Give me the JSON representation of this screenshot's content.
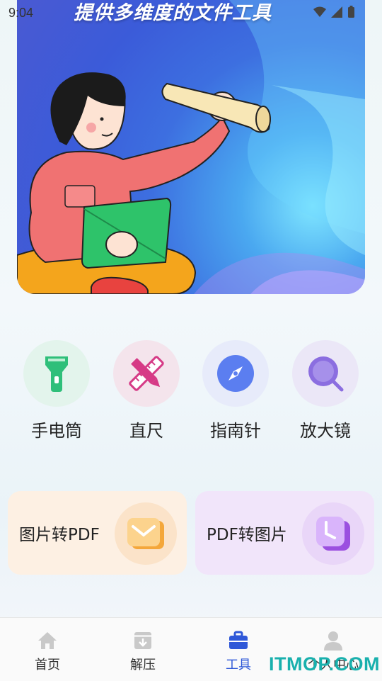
{
  "status_bar": {
    "time": "9:04"
  },
  "banner": {
    "title": "提供多维度的文件工具"
  },
  "tools": [
    {
      "label": "手电筒",
      "icon": "flashlight-icon",
      "bg": "#e6f5ef",
      "color": "#2fbf7a"
    },
    {
      "label": "直尺",
      "icon": "ruler-pencil-icon",
      "bg": "#f4e6ee",
      "color": "#d63a86"
    },
    {
      "label": "指南针",
      "icon": "compass-icon",
      "bg": "#e8ecfb",
      "color": "#5b7ef0"
    },
    {
      "label": "放大镜",
      "icon": "magnifier-icon",
      "bg": "#ece8f8",
      "color": "#8b6ee0"
    }
  ],
  "cards": [
    {
      "label": "图片转PDF",
      "icon": "image-to-pdf-icon",
      "bg": "#fdf1e4"
    },
    {
      "label": "PDF转图片",
      "icon": "pdf-to-image-icon",
      "bg": "#f1e6fb"
    }
  ],
  "nav": [
    {
      "label": "首页",
      "icon": "home-icon",
      "active": false
    },
    {
      "label": "解压",
      "icon": "unzip-icon",
      "active": false
    },
    {
      "label": "工具",
      "icon": "toolbox-icon",
      "active": true
    },
    {
      "label": "个人中心",
      "icon": "user-icon",
      "active": false
    }
  ],
  "watermark": "ITMOP.COM"
}
